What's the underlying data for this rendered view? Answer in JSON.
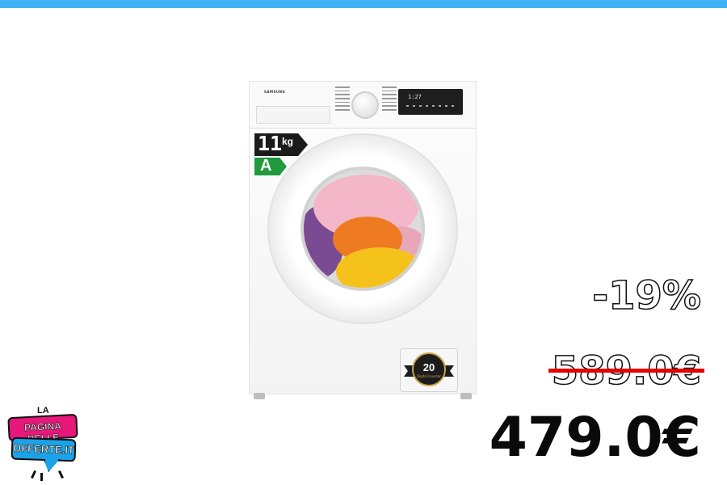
{
  "colors": {
    "top_bar": "#3db2f5",
    "strike_line": "#e60000",
    "energy_class": "#1f9a3c",
    "logo_pink": "#e8177a",
    "logo_blue": "#1aa3e8"
  },
  "product": {
    "brand_logo": "SAMSUNG",
    "display_readout": "1:27",
    "energy_label": {
      "capacity": "11",
      "unit": "kg",
      "energy_class": "A"
    },
    "warranty_badge": {
      "years": "20",
      "caption": "Digital Inverter"
    }
  },
  "pricing": {
    "discount": "-19%",
    "old_price": "589.0€",
    "new_price": "479.0€"
  },
  "site_logo": {
    "line1": "LA",
    "line2": "PAGINA DELLE",
    "line3": "OFFERTE.IT"
  }
}
